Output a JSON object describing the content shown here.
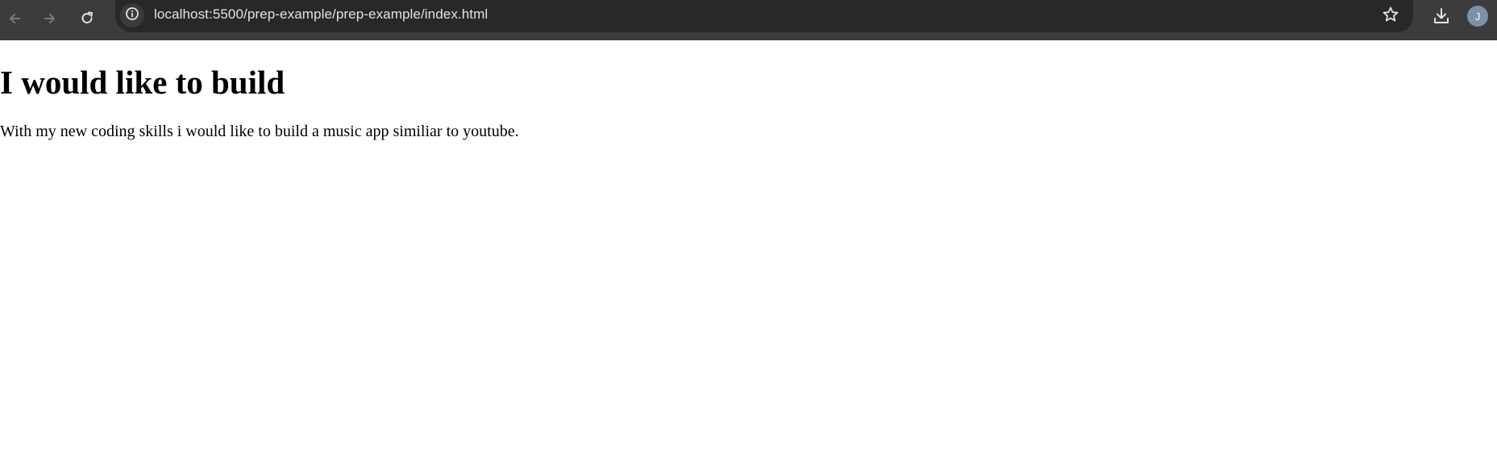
{
  "browser": {
    "url": "localhost:5500/prep-example/prep-example/index.html",
    "profile_initial": "J",
    "icons": {
      "back": "arrow-left-icon",
      "forward": "arrow-right-icon",
      "reload": "reload-icon",
      "site_info": "info-icon",
      "bookmark": "star-icon",
      "downloads": "download-icon"
    },
    "colors": {
      "toolbar_bg": "#3c3c3c",
      "omnibox_bg": "#282828",
      "avatar_bg": "#7a93a8"
    }
  },
  "page": {
    "heading": "I would like to build",
    "paragraph": "With my new coding skills i would like to build a music app similiar to youtube."
  }
}
